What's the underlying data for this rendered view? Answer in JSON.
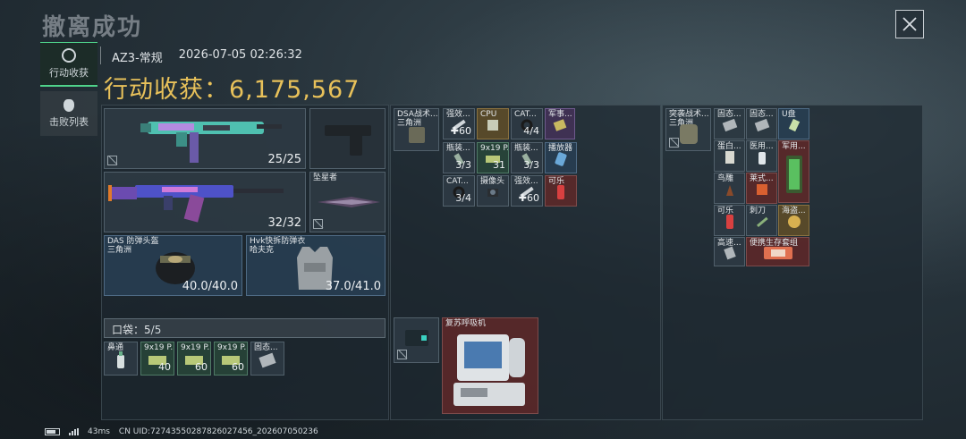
{
  "header": {
    "title": "撤离成功",
    "close_icon": "close-icon"
  },
  "side_tabs": [
    {
      "label": "行动收获",
      "icon": "loot-icon",
      "active": true
    },
    {
      "label": "击败列表",
      "icon": "skull-icon",
      "active": false
    }
  ],
  "meta": {
    "map": "AZ3-常规",
    "datetime": "2026-07-05 02:26:32"
  },
  "harvest": {
    "label": "行动收获：",
    "value": "6,175,567"
  },
  "loadout": {
    "primary_weapon": {
      "ammo": "25/25",
      "icon": "smg-icon"
    },
    "pistol": {
      "icon": "pistol-icon"
    },
    "secondary_weapon": {
      "ammo": "32/32",
      "icon": "rifle-icon"
    },
    "melee": {
      "label": "坠星者",
      "icon": "knife-icon"
    },
    "helmet": {
      "name": "DAS 防弹头盔",
      "faction": "三角洲",
      "durability": "40.0/40.0"
    },
    "armor": {
      "name": "Hvk快拆防弹衣",
      "faction": "哈夫克",
      "durability": "37.0/41.0"
    },
    "pocket": {
      "label": "口袋：",
      "used": "5",
      "sep": "/",
      "total": "5"
    },
    "pocket_items": [
      {
        "label": "鼻通",
        "count": ""
      },
      {
        "label": "9x19 P...",
        "count": "40"
      },
      {
        "label": "9x19 P...",
        "count": "60"
      },
      {
        "label": "9x19 P...",
        "count": "60"
      },
      {
        "label": "固态...",
        "count": ""
      }
    ]
  },
  "chest_rig": {
    "name": "DSA战术...",
    "faction": "三角洲",
    "items": [
      {
        "label": "强效...",
        "count": "60"
      },
      {
        "label": "CPU",
        "count": ""
      },
      {
        "label": "CAT...",
        "count": "4/4"
      },
      {
        "label": "军事...",
        "count": ""
      },
      {
        "label": "瓶装...",
        "count": "3/3"
      },
      {
        "label": "9x19 P...",
        "count": "31"
      },
      {
        "label": "瓶装...",
        "count": "3/3"
      },
      {
        "label": "播放器",
        "count": ""
      },
      {
        "label": "CAT...",
        "count": "3/4"
      },
      {
        "label": "摄像头",
        "count": ""
      },
      {
        "label": "强效...",
        "count": "60"
      },
      {
        "label": "可乐",
        "count": ""
      }
    ]
  },
  "backpack": {
    "name": "突袭战术...",
    "faction": "三角洲",
    "items": [
      {
        "label": "固态...",
        "count": ""
      },
      {
        "label": "固态...",
        "count": ""
      },
      {
        "label": "U盘",
        "count": ""
      },
      {
        "label": "蛋白...",
        "count": ""
      },
      {
        "label": "医用...",
        "count": ""
      },
      {
        "label": "军用...",
        "count": ""
      },
      {
        "label": "鸟雕",
        "count": ""
      },
      {
        "label": "莱式...",
        "count": ""
      },
      {
        "label": "可乐",
        "count": ""
      },
      {
        "label": "刺刀",
        "count": ""
      },
      {
        "label": "海盗...",
        "count": ""
      },
      {
        "label": "高速...",
        "count": ""
      },
      {
        "label": "便携生存套组",
        "count": ""
      }
    ]
  },
  "safe_box": {
    "item_label": "复苏呼吸机"
  },
  "footer": {
    "latency": "43ms",
    "uid": "CN UID:7274355028782602745­6_202607050236"
  }
}
